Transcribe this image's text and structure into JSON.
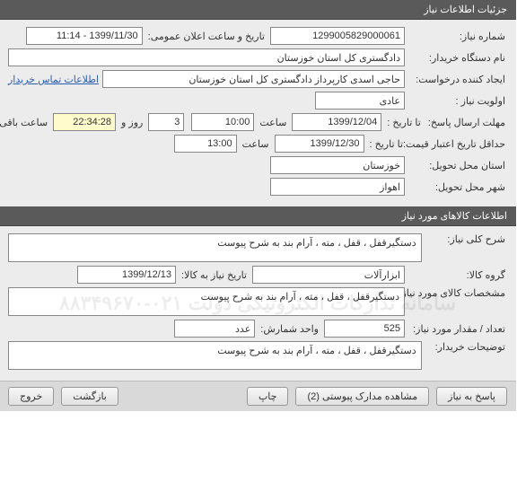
{
  "sections": {
    "need_info_title": "جزئیات اطلاعات نیاز",
    "goods_info_title": "اطلاعات کالاهای مورد نیاز"
  },
  "labels": {
    "need_number": "شماره نیاز:",
    "public_ann_date": "تاریخ و ساعت اعلان عمومی:",
    "buyer_org": "نام دستگاه خریدار:",
    "creator": "ایجاد کننده درخواست:",
    "contact_link": "اطلاعات تماس خریدار",
    "priority": "اولویت نیاز :",
    "deadline": "مهلت ارسال پاسخ:",
    "until_date": "تا تاریخ :",
    "time": "ساعت",
    "days_and": "روز و",
    "time_left": "ساعت باقی مانده",
    "min_valid": "حداقل تاریخ اعتبار قیمت:",
    "delivery_province": "استان محل تحویل:",
    "delivery_city": "شهر محل تحویل:",
    "need_desc": "شرح کلی نیاز:",
    "goods_group": "گروه کالا:",
    "need_by_date": "تاریخ نیاز به کالا:",
    "goods_spec": "مشخصات کالای مورد نیاز:",
    "qty": "تعداد / مقدار مورد نیاز:",
    "unit": "واحد شمارش:",
    "buyer_notes": "توضیحات خریدار:"
  },
  "values": {
    "need_number": "1299005829000061",
    "public_ann_date": "1399/11/30 - 11:14",
    "buyer_org": "دادگستری کل استان خوزستان",
    "creator": "حاجی اسدی کارپرداز دادگستری کل استان خوزستان",
    "priority": "عادی",
    "deadline_date": "1399/12/04",
    "deadline_time": "10:00",
    "days_left": "3",
    "clock_left": "22:34:28",
    "min_valid_date": "1399/12/30",
    "min_valid_time": "13:00",
    "province": "خوزستان",
    "city": "اهواز",
    "need_desc": "دستگیرقفل ، قفل ، مته ، آرام بند به شرح پیوست",
    "goods_group": "ابزارآلات",
    "need_by_date": "1399/12/13",
    "goods_spec": "دستگیرقفل ، قفل ، مته ، آرام بند به شرح پیوست",
    "qty": "525",
    "unit": "عدد",
    "buyer_notes": "دستگیرقفل ، قفل ، مته ، آرام بند به شرح پیوست"
  },
  "watermark": "سامانه تدارکات الکترونیکی دولت\n۰۲۱-۸۸۳۴۹۶۷۰",
  "actions": {
    "reply": "پاسخ به نیاز",
    "attachments": "مشاهده مدارک پیوستی (2)",
    "print": "چاپ",
    "back": "بازگشت",
    "exit": "خروج"
  }
}
